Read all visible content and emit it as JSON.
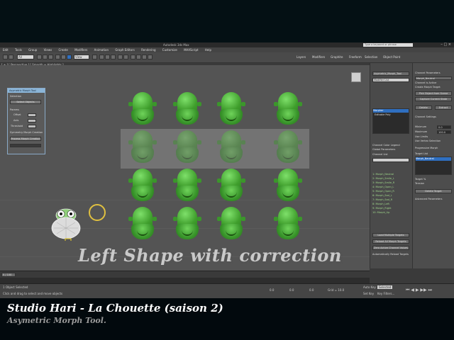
{
  "app": {
    "title": "Autodesk 3ds Max",
    "search_placeholder": "Type a keyword or phrase",
    "menu": [
      "Edit",
      "Tools",
      "Group",
      "Views",
      "Create",
      "Modifiers",
      "Animation",
      "Graph Editors",
      "Rendering",
      "Customize",
      "MAXScript",
      "Help"
    ],
    "toolbar_dropdown": "All",
    "toolbar_view_dropdown": "View",
    "toolbar_tabs": [
      "Layers",
      "Modifiers",
      "Graphite",
      "Freeform",
      "Selection",
      "Object Paint"
    ]
  },
  "viewport": {
    "label": "[ + ] [ Perspective ] [ Smooth + Highlights ]",
    "overlay_text": "Left Shape with correction"
  },
  "dialog": {
    "title": "Asymetric Morph Tool",
    "selection_label": "Selection",
    "select_button": "Select Objects",
    "params_label": "Params",
    "offset_label": "Offset",
    "axis_label": "Axis",
    "threshold_label": "Threshold",
    "symmetry_label": "Symmetry Morph Creation",
    "process_button": "Process Morph Creation"
  },
  "command_panel": {
    "object_name": "Asymetric_Morph_Tool",
    "modifier_list": "Modifier List",
    "stack_items": [
      "Morpher",
      "Editable Poly"
    ],
    "channel_color_legend": "Channel Color Legend",
    "global_parameters": "Global Parameters",
    "channel_list": "Channel List",
    "channels": [
      "1: Morph_Neutral",
      "2: Morph_Smile_L",
      "3: Morph_Smile_R",
      "4: Morph_Open_L",
      "5: Morph_Open_R",
      "6: Morph_Sad_L",
      "7: Morph_Sad_R",
      "8: Morph_Left",
      "9: Morph_Right",
      "10: Morph_Up"
    ],
    "load_button": "Load Multiple Targets",
    "reload_button": "Reload All Morph Targets",
    "zero_button": "Zero Active Channel Values",
    "auto_reload": "Automatically Reload Targets"
  },
  "props_panel": {
    "channel_parameters": "Channel Parameters",
    "channel_name": "Morph_Neutral",
    "channel_active": "Channel is Active",
    "create_target": "Create Morph Target",
    "pick_button": "Pick Object from Scene",
    "capture_button": "Capture Current State",
    "delete_button": "Delete",
    "extract_button": "Extract",
    "channel_settings": "Channel Settings",
    "minimum_label": "Minimum",
    "maximum_label": "Maximum",
    "minimum_value": "0.0",
    "maximum_value": "100.0",
    "use_limits": "Use Limits",
    "use_vertex": "Use Vertex Selection",
    "progressive": "Progressive Morph",
    "target_list": "Target List",
    "target_item": "Morph_Neutral",
    "target_pct_label": "Target %",
    "tension_label": "Tension",
    "delete_target": "Delete Target",
    "advanced": "Advanced Parameters"
  },
  "timeline": {
    "frame": "0 / 100",
    "status_msg": "Click and drag to select and move objects",
    "selected": "1 Object Selected",
    "auto_key": "Auto Key",
    "set_key": "Set Key",
    "key_filters": "Key Filters...",
    "selected_dropdown": "Selected",
    "x_value": "0.0",
    "y_value": "0.0",
    "z_value": "0.0",
    "grid": "Grid = 10.0"
  },
  "captions": {
    "line1": "Studio Hari -  La Chouette (saison 2)",
    "line2": "Asymetric Morph Tool."
  },
  "colors": {
    "accent": "#2f6fc0",
    "morph_green": "#4cae36",
    "overlay_text": "#c9c9c9"
  }
}
